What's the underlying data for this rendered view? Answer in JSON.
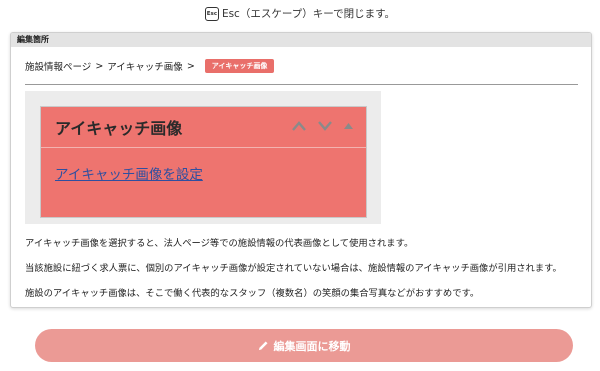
{
  "hint": {
    "key_label": "Esc",
    "text": "Esc（エスケープ）キーで閉じます。"
  },
  "panel": {
    "title": "編集箇所"
  },
  "breadcrumb": {
    "items": [
      "施設情報ページ",
      "アイキャッチ画像"
    ],
    "separator": ">",
    "badge": "アイキャッチ画像"
  },
  "widget": {
    "title": "アイキャッチ画像",
    "link": "アイキャッチ画像を設定",
    "controls": [
      "chevron-up-icon",
      "chevron-down-icon",
      "triangle-up-icon"
    ],
    "bg_color": "#ee746f"
  },
  "description": [
    "アイキャッチ画像を選択すると、法人ページ等での施設情報の代表画像として使用されます。",
    "当該施設に紐づく求人票に、個別のアイキャッチ画像が設定されていない場合は、施設情報のアイキャッチ画像が引用されます。",
    "施設のアイキャッチ画像は、そこで働く代表的なスタッフ（複数名）の笑顔の集合写真などがおすすめです。"
  ],
  "button": {
    "label": "編集画面に移動",
    "icon": "pencil-icon",
    "color": "#eb9a95"
  }
}
